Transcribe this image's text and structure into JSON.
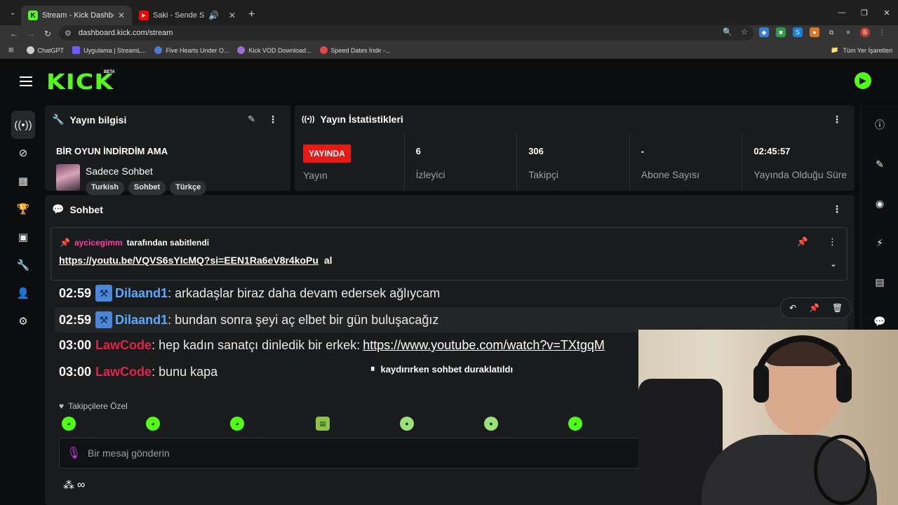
{
  "browser": {
    "tabs": [
      {
        "title": "Stream - Kick Dashboard",
        "favicon": "K",
        "favicon_color": "#53fc18",
        "active": true
      },
      {
        "title": "Saki - Sende Sev Ama Sevil",
        "favicon": "▶",
        "favicon_color": "#ff0000",
        "active": false
      }
    ],
    "url": "dashboard.kick.com/stream",
    "bookmarks": [
      {
        "label": "ChatGPT",
        "color": "#cfcfcf"
      },
      {
        "label": "Uygulama | StreamL...",
        "color": "#6f5cff"
      },
      {
        "label": "Five Hearts Under O...",
        "color": "#4a7bd0"
      },
      {
        "label": "Kick VOD Download...",
        "color": "#a06cd5"
      },
      {
        "label": "Speed Dates İndir -...",
        "color": "#e04848"
      }
    ],
    "bookmarks_right": "Tüm Yer İşaretleri"
  },
  "kick": {
    "logo": "KICK",
    "beta": "BETA"
  },
  "stream_info": {
    "header": "Yayın bilgisi",
    "title": "BİR OYUN İNDİRDİM AMA",
    "category": "Sadece Sohbet",
    "tags": [
      "Turkish",
      "Sohbet",
      "Türkçe"
    ]
  },
  "stream_stats": {
    "header": "Yayın İstatistikleri",
    "live_badge": "YAYINDA",
    "items": [
      {
        "value": "",
        "label": "Yayın"
      },
      {
        "value": "6",
        "label": "İzleyici"
      },
      {
        "value": "306",
        "label": "Takipçi"
      },
      {
        "value": "-",
        "label": "Abone Sayısı"
      },
      {
        "value": "02:45:57",
        "label": "Yayında Olduğu Süre"
      }
    ]
  },
  "chat": {
    "header": "Sohbet",
    "pinned": {
      "user": "aycicegimm",
      "by_text": "tarafından sabitlendi",
      "link": "https://youtu.be/VQVS6sYIcMQ?si=EEN1Ra6eV8r4koPu",
      "suffix": "al"
    },
    "messages": [
      {
        "time": "02:59",
        "user": "Dilaand1",
        "text": "arkadaşlar biraz daha devam edersek ağlıycam",
        "color": "blue",
        "badge": true
      },
      {
        "time": "02:59",
        "user": "Dilaand1",
        "text": "bundan sonra şeyi aç elbet bir gün buluşacağız",
        "color": "blue",
        "badge": true
      },
      {
        "time": "03:00",
        "user": "LawCode",
        "text": "hep kadın sanatçı dinledik bir erkek:",
        "link": "https://www.youtube.com/watch?v=TXtgqM",
        "color": "red",
        "badge": false
      },
      {
        "time": "03:00",
        "user": "LawCode",
        "text": "bunu kapa",
        "color": "red",
        "badge": false
      }
    ],
    "paused": "kaydırırken sohbet duraklatıldı",
    "follower_only": "Takipçilere Özel",
    "input_placeholder": "Bir mesaj gönderin",
    "infinity": "∞"
  }
}
